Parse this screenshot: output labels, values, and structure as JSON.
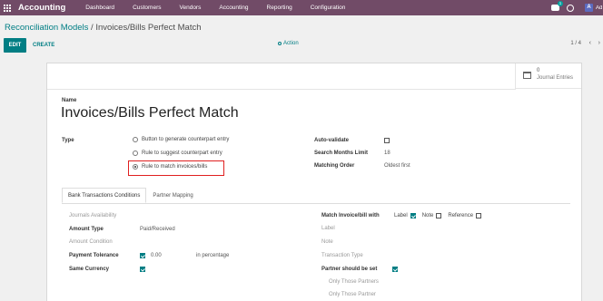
{
  "navbar": {
    "app_name": "Accounting",
    "menu": [
      "Dashboard",
      "Customers",
      "Vendors",
      "Accounting",
      "Reporting",
      "Configuration"
    ],
    "chat_badge": "1",
    "user_initial": "A",
    "user_name": "Ad"
  },
  "breadcrumb": {
    "parent": "Reconciliation Models",
    "separator": " / ",
    "current": "Invoices/Bills Perfect Match"
  },
  "control_panel": {
    "edit_label": "EDIT",
    "create_label": "CREATE",
    "action_label": "Action",
    "pager": "1 / 4",
    "prev_icon": "‹",
    "next_icon": "›"
  },
  "smart_button": {
    "count": "0",
    "label": "Journal Entries"
  },
  "form": {
    "name_label": "Name",
    "name_value": "Invoices/Bills Perfect Match",
    "type_label": "Type",
    "type_options": [
      {
        "label": "Button to generate counterpart entry",
        "selected": false
      },
      {
        "label": "Rule to suggest counterpart entry",
        "selected": false
      },
      {
        "label": "Rule to match invoices/bills",
        "selected": true
      }
    ],
    "auto_validate_label": "Auto-validate",
    "auto_validate": false,
    "search_months_label": "Search Months Limit",
    "search_months_value": "18",
    "matching_order_label": "Matching Order",
    "matching_order_value": "Oldest first"
  },
  "tabs": [
    {
      "label": "Bank Transactions Conditions",
      "active": true
    },
    {
      "label": "Partner Mapping",
      "active": false
    }
  ],
  "conditions": {
    "journals_availability": "Journals Availability",
    "amount_type_label": "Amount Type",
    "amount_type_value": "Paid/Received",
    "amount_condition": "Amount Condition",
    "payment_tolerance_label": "Payment Tolerance",
    "payment_tolerance_value": "0.00",
    "payment_tolerance_unit": "in percentage",
    "same_currency_label": "Same Currency",
    "match_with_label": "Match Invoice/bill with",
    "match_label_option": "Label",
    "match_note_option": "Note",
    "match_reference_option": "Reference",
    "label_field": "Label",
    "note_field": "Note",
    "transaction_type_field": "Transaction Type",
    "partner_should_be_set_label": "Partner should be set",
    "only_partners": "Only Those Partners",
    "only_partner_cats": "Only Those Partner"
  },
  "colors": {
    "navbar": "#714B67",
    "primary": "#017e84",
    "highlight": "#e02020"
  }
}
